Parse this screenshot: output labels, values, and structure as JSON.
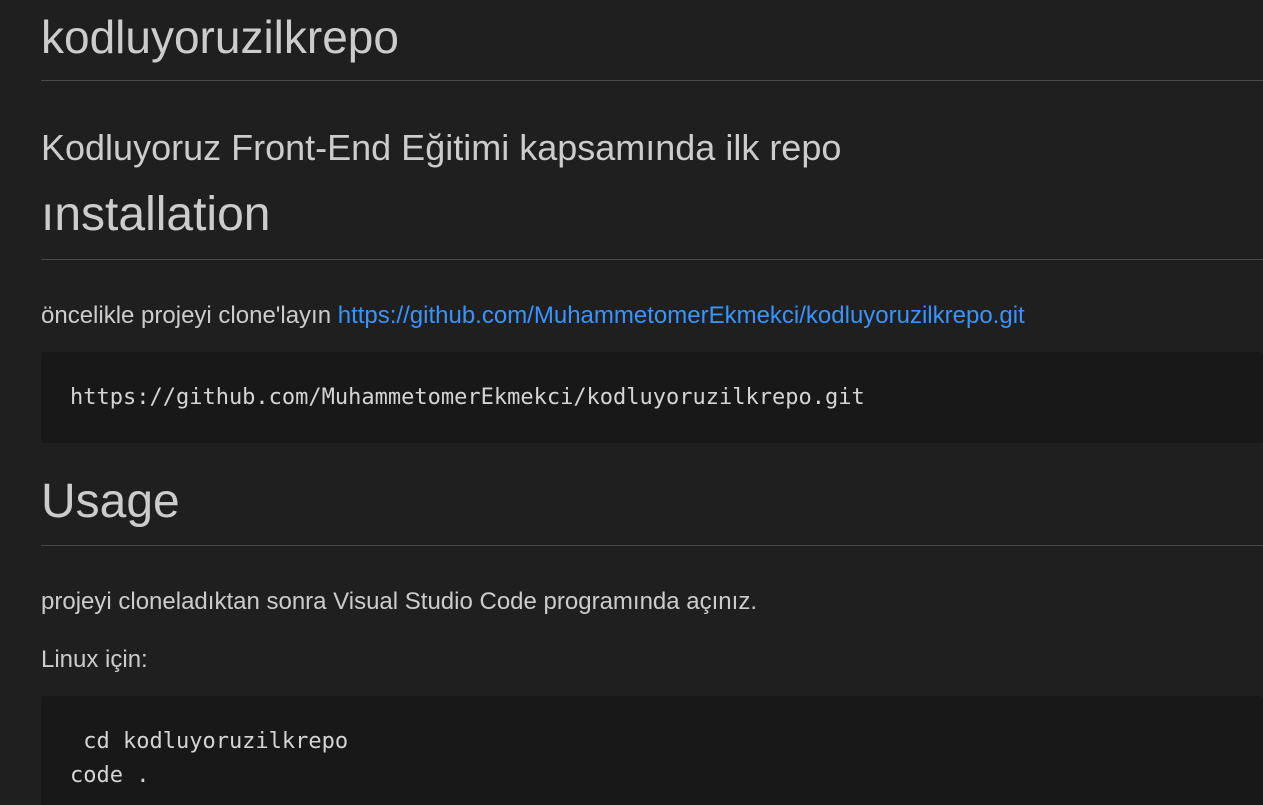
{
  "document": {
    "title": "kodluyoruzilkrepo",
    "subtitle": "Kodluyoruz Front-End Eğitimi kapsamında ilk repo",
    "installation": {
      "heading": "ınstallation",
      "intro_text": "öncelikle projeyi clone'layın ",
      "link_text": "https://github.com/MuhammetomerEkmekci/kodluyoruzilkrepo.git",
      "code": "https://github.com/MuhammetomerEkmekci/kodluyoruzilkrepo.git"
    },
    "usage": {
      "heading": "Usage",
      "paragraph": "projeyi cloneladıktan sonra Visual Studio Code programında açınız.",
      "linux_label": "Linux için:",
      "code_lines": [
        " cd kodluyoruzilkrepo",
        "code ."
      ]
    }
  },
  "colors": {
    "background": "#1f1f1f",
    "text": "#cccccc",
    "link": "#3794ff",
    "code_background": "#181818",
    "rule": "#4a4a4a"
  }
}
